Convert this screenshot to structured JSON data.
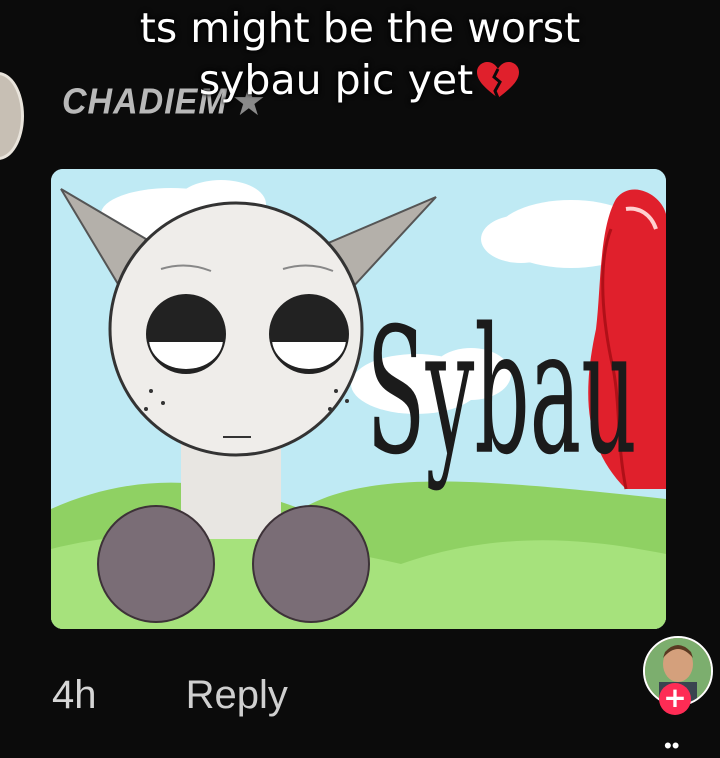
{
  "caption": {
    "line1": "ts might be the worst",
    "line2": "sybau pic yet",
    "emoji_icon": "broken-heart-icon"
  },
  "comment": {
    "username": "CHADIEM",
    "username_badge": "★",
    "image_text": "Sybau",
    "time": "4h",
    "reply_label": "Reply"
  },
  "creator": {
    "follow_label": "+"
  },
  "colors": {
    "background": "#0b0b0b",
    "sky": "#bfeaf4",
    "grass": "#9fdd72",
    "follow": "#fe2c55",
    "heart": "#e0202c"
  }
}
